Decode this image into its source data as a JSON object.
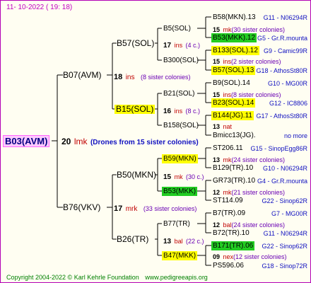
{
  "header": {
    "date": "11- 10-2022 ( 19: 18)"
  },
  "root": {
    "label": "B03(AVM)",
    "num": "20",
    "ins": "lmk",
    "note": "(Drones from 15 sister colonies)"
  },
  "gen1": [
    {
      "label": "B07(AVM)",
      "num": "18",
      "ins": "ins",
      "note": "(8 sister colonies)"
    },
    {
      "label": "B76(VKV)",
      "num": "17",
      "ins": "mrk",
      "note": "(33 sister colonies)"
    }
  ],
  "gen2": [
    {
      "label": "B57(SOL)",
      "num": "17",
      "ins": "ins",
      "note": "(4 c.)"
    },
    {
      "label": "B15(SOL)",
      "num": "16",
      "ins": "ins",
      "note": "(8 c.)"
    },
    {
      "label": "B50(MKN)",
      "num": "15",
      "ins": "mk",
      "note": "(30 c.)"
    },
    {
      "label": "B26(TR)",
      "num": "13",
      "ins": "bal",
      "note": "(22 c.)"
    }
  ],
  "gen3": [
    {
      "label": "B5(SOL)",
      "num": "15",
      "ins": "mk",
      "note": "(30 sister colonies)"
    },
    {
      "label": "B300(SOL)",
      "num": "15",
      "ins": "ins",
      "note": "(2 sister colonies)"
    },
    {
      "label": "B21(SOL)",
      "num": "15",
      "ins": "ins",
      "note": "(8 sister colonies)"
    },
    {
      "label": "B158(SOL)",
      "num": "13",
      "ins": "nat",
      "note": ""
    },
    {
      "label": "B59(MKN)",
      "num": "13",
      "ins": "mk",
      "note": "(24 sister colonies)"
    },
    {
      "label": "B53(MKK)",
      "num": "12",
      "ins": "mk",
      "note": "(21 sister colonies)"
    },
    {
      "label": "B77(TR)",
      "num": "12",
      "ins": "bal",
      "note": "(24 sister colonies)"
    },
    {
      "label": "B47(MKK)",
      "num": "09",
      "ins": "nex",
      "note": "(12 sister colonies)"
    }
  ],
  "leaves": [
    {
      "label": "B58(MKN).13",
      "code": "G11 - N06294R"
    },
    {
      "label": "B53(MKK).12",
      "code": "G5 - Gr.R.mounta"
    },
    {
      "label": "B133(SOL).12",
      "code": "G9 - Camic99R"
    },
    {
      "label": "B57(SOL).13",
      "code": "G18 - AthosSt80R"
    },
    {
      "label": "B9(SOL).14",
      "code": "G10 - MG00R"
    },
    {
      "label": "B23(SOL).14",
      "code": "G12 - IC8806"
    },
    {
      "label": "B144(JG).11",
      "code": "G17 - AthosSt80R"
    },
    {
      "label": "Bmicc13(JG).",
      "code": "no more"
    },
    {
      "label": "ST206.11",
      "code": "G15 - SinopEgg86R"
    },
    {
      "label": "B129(TR).10",
      "code": "G10 - N06294R"
    },
    {
      "label": "GR73(TR).10",
      "code": "G4 - Gr.R.mounta"
    },
    {
      "label": "ST114.09",
      "code": "G22 - Sinop62R"
    },
    {
      "label": "B7(TR).09",
      "code": "G7 - MG00R"
    },
    {
      "label": "B72(TR).10",
      "code": "G11 - N06294R"
    },
    {
      "label": "B171(TR).06",
      "code": "G22 - Sinop62R"
    },
    {
      "label": "PS596.06",
      "code": "G18 - Sinop72R"
    }
  ],
  "footer": {
    "copyright": "Copyright 2004-2022 © Karl Kehrle Foundation",
    "url": "www.pedigreeapis.org"
  }
}
